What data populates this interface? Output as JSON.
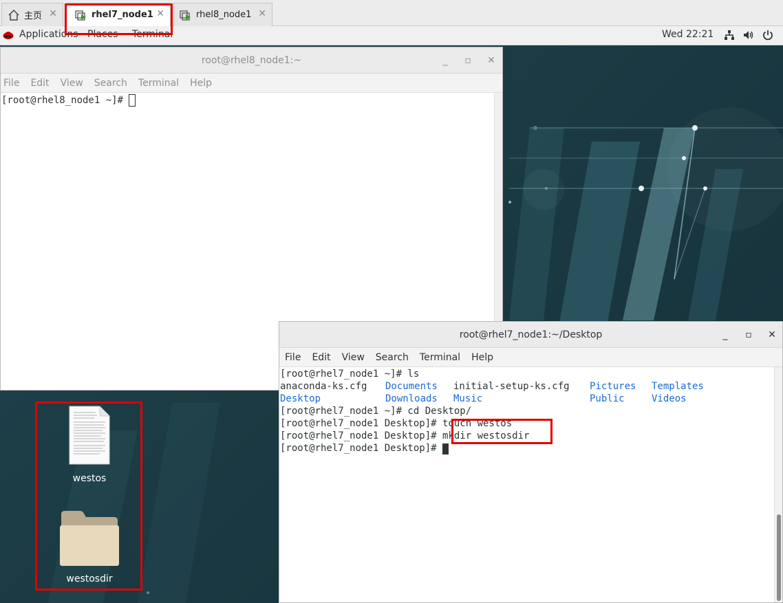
{
  "vm_tabs": [
    {
      "label": "主页",
      "icon": "home-icon"
    },
    {
      "label": "rhel7_node1",
      "icon": "vm-icon"
    },
    {
      "label": "rhel8_node1",
      "icon": "vm-icon"
    }
  ],
  "tab_close": "✕",
  "panel": {
    "applications": "Applications",
    "places": "Places",
    "terminal": "Terminal",
    "clock": "Wed 22:21"
  },
  "win_back": {
    "title": "root@rhel8_node1:~",
    "menu": [
      "File",
      "Edit",
      "View",
      "Search",
      "Terminal",
      "Help"
    ],
    "prompt": "[root@rhel8_node1 ~]# "
  },
  "win_front": {
    "title": "root@rhel7_node1:~/Desktop",
    "menu": [
      "File",
      "Edit",
      "View",
      "Search",
      "Terminal",
      "Help"
    ],
    "lines": {
      "l1": "[root@rhel7_node1 ~]# ls",
      "ls_a1": "anaconda-ks.cfg",
      "ls_a2": "Documents",
      "ls_a3": "initial-setup-ks.cfg",
      "ls_a4": "Pictures",
      "ls_a5": "Templates",
      "ls_b1": "Desktop",
      "ls_b2": "Downloads",
      "ls_b3": "Music",
      "ls_b4": "Public",
      "ls_b5": "Videos",
      "l4": "[root@rhel7_node1 ~]# cd Desktop/",
      "p5": "[root@rhel7_node1 Desktop]# ",
      "c5": "touch westos",
      "p6": "[root@rhel7_node1 Desktop]# ",
      "c6": "mkdir westosdir",
      "p7": "[root@rhel7_node1 Desktop]# "
    }
  },
  "desktop_icons": [
    {
      "label": "westos",
      "icon": "text-file-icon"
    },
    {
      "label": "westosdir",
      "icon": "folder-icon"
    }
  ],
  "colors": {
    "highlight": "#e00000",
    "link_blue": "#1a6bd6"
  }
}
